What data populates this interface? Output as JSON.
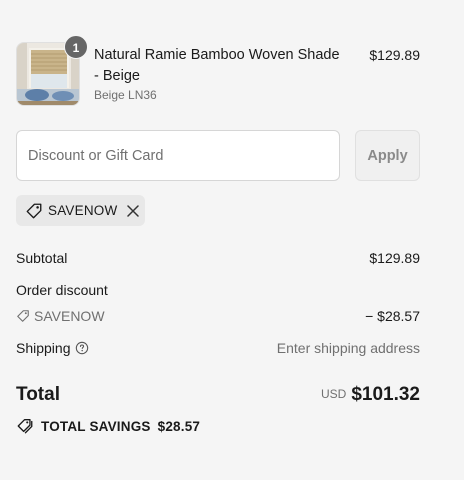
{
  "line_item": {
    "quantity": "1",
    "title": "Natural Ramie Bamboo Woven Shade - Beige",
    "variant": "Beige LN36",
    "price": "$129.89"
  },
  "discount": {
    "placeholder": "Discount or Gift Card",
    "value": "",
    "apply_label": "Apply",
    "applied_code": "SAVENOW"
  },
  "summary": {
    "subtotal_label": "Subtotal",
    "subtotal_value": "$129.89",
    "order_discount_label": "Order discount",
    "order_discount_code": "SAVENOW",
    "order_discount_value": "− $28.57",
    "shipping_label": "Shipping",
    "shipping_value": "Enter shipping address",
    "total_label": "Total",
    "currency": "USD",
    "total_value": "$101.32",
    "savings_label": "TOTAL SAVINGS",
    "savings_value": "$28.57"
  },
  "icons": {
    "chip_tag": "tag-icon",
    "chip_remove": "close-icon",
    "discount_tag": "tag-icon",
    "shipping_help": "question-circle-icon",
    "savings": "tags-icon"
  },
  "colors": {
    "background": "#f5f5f5",
    "muted_text": "#707070",
    "badge": "#666666"
  }
}
